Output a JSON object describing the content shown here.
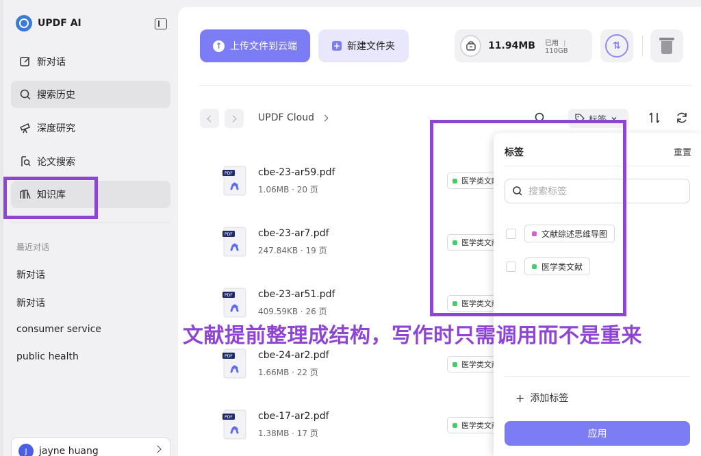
{
  "app": {
    "name": "UPDF AI"
  },
  "sidebar": {
    "items": [
      {
        "label": "新对话",
        "icon": "new-chat-icon"
      },
      {
        "label": "搜索历史",
        "icon": "search-icon"
      },
      {
        "label": "深度研究",
        "icon": "telescope-icon"
      },
      {
        "label": "论文搜索",
        "icon": "paper-search-icon"
      },
      {
        "label": "知识库",
        "icon": "library-icon"
      }
    ],
    "recent_title": "最近对话",
    "recent": [
      "新对话",
      "新对话",
      "consumer service",
      "public health"
    ],
    "user": {
      "name": "jayne huang",
      "avatar_letter": "J"
    }
  },
  "toolbar": {
    "upload_label": "上传文件到云端",
    "new_folder_label": "新建文件夹",
    "storage": {
      "used": "11.94MB",
      "used_label": "已用",
      "separator": "|",
      "total": "110GB"
    }
  },
  "breadcrumb": {
    "root": "UPDF Cloud"
  },
  "filter": {
    "tags_label": "标签"
  },
  "files": [
    {
      "name": "cbe-23-ar59.pdf",
      "meta": "1.06MB · 20 页",
      "tag": "医学类文献"
    },
    {
      "name": "cbe-23-ar7.pdf",
      "meta": "247.84KB · 19 页",
      "tag": "医学类文献"
    },
    {
      "name": "cbe-23-ar51.pdf",
      "meta": "409.59KB · 26 页",
      "tag": "医学类文献"
    },
    {
      "name": "cbe-24-ar2.pdf",
      "meta": "1.66MB · 22 页",
      "tag": "医学类文献"
    },
    {
      "name": "cbe-17-ar2.pdf",
      "meta": "1.38MB · 17 页",
      "tag": "医学类文献"
    }
  ],
  "tag_panel": {
    "title": "标签",
    "reset": "重置",
    "search_placeholder": "搜索标签",
    "options": [
      {
        "label": "文献综述思维导图",
        "color": "#e05ad6"
      },
      {
        "label": "医学类文献",
        "color": "#3fd169"
      }
    ],
    "add_label": "添加标签",
    "apply_label": "应用"
  },
  "overlay": {
    "caption": "文献提前整理成结构，写作时只需调用而不是重来"
  },
  "colors": {
    "accent": "#7c7cf5",
    "highlight": "#8f45d4",
    "tag_green": "#3fd169",
    "tag_pink": "#e05ad6"
  }
}
